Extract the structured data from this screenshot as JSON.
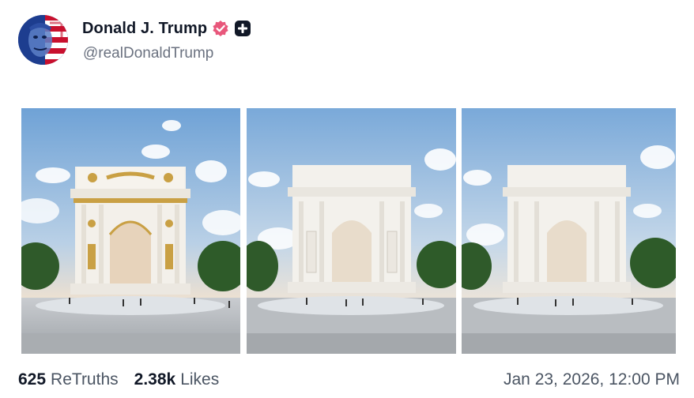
{
  "post": {
    "author": {
      "display_name": "Donald J. Trump",
      "handle": "@realDonaldTrump",
      "verified_icon": "verified-check-icon",
      "badge_icon": "plus-badge-icon"
    },
    "media": [
      {
        "variant": "gilded arch with gold statues"
      },
      {
        "variant": "white arch with white statues"
      },
      {
        "variant": "plain white arch"
      }
    ],
    "stats": {
      "retruths_count": "625",
      "retruths_label": "ReTruths",
      "likes_count": "2.38k",
      "likes_label": "Likes"
    },
    "timestamp": "Jan 23, 2026, 12:00 PM"
  },
  "colors": {
    "verified_badge": "#e8577b",
    "plus_badge": "#111827",
    "sky_top": "#7fb0e0",
    "sky_bottom": "#e6eef5",
    "marble": "#f1efe9",
    "gold": "#c9a044",
    "text_primary": "#111827",
    "text_secondary": "#6b7280"
  }
}
